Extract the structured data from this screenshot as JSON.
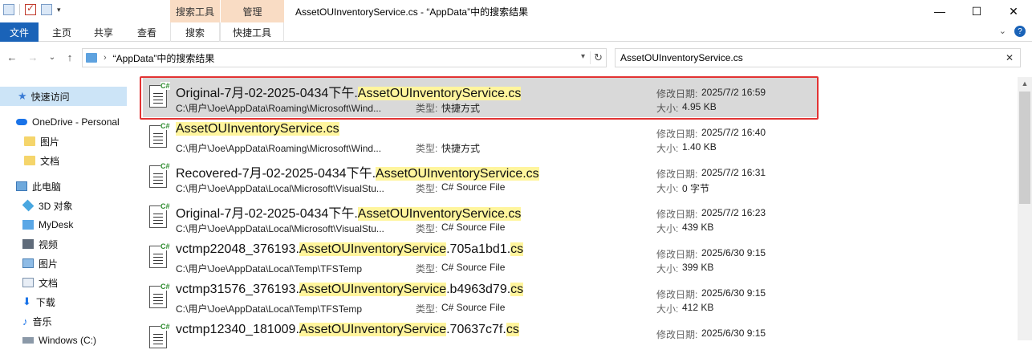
{
  "window": {
    "title": "AssetOUInventoryService.cs - “AppData”中的搜索结果",
    "minimize": "—",
    "maximize": "☐",
    "close": "✕"
  },
  "contextual": {
    "search_tools": "搜索工具",
    "manage": "管理"
  },
  "ribbon": {
    "tabs": [
      "文件",
      "主页",
      "共享",
      "查看",
      "搜索",
      "快捷工具"
    ]
  },
  "nav": {
    "back": "←",
    "forward": "→",
    "recent": "⌄",
    "up": "↑"
  },
  "address": {
    "path": "“AppData”中的搜索结果",
    "refresh": "↻"
  },
  "search": {
    "value": "AssetOUInventoryService.cs",
    "clear": "✕"
  },
  "sidebar": {
    "items": [
      {
        "label": "快速访问",
        "icon": "star-icon"
      },
      {
        "label": "OneDrive - Personal",
        "icon": "cloud-icon"
      },
      {
        "label": "图片",
        "icon": "folder-icon"
      },
      {
        "label": "文档",
        "icon": "folder-icon"
      },
      {
        "label": "此电脑",
        "icon": "computer-icon"
      },
      {
        "label": "3D 对象",
        "icon": "cube-icon"
      },
      {
        "label": "MyDesk",
        "icon": "desktop-icon"
      },
      {
        "label": "视频",
        "icon": "video-icon"
      },
      {
        "label": "图片",
        "icon": "picture-icon"
      },
      {
        "label": "文档",
        "icon": "document-icon"
      },
      {
        "label": "下载",
        "icon": "download-icon"
      },
      {
        "label": "音乐",
        "icon": "music-icon"
      },
      {
        "label": "Windows (C:)",
        "icon": "drive-icon"
      }
    ]
  },
  "labels": {
    "type": "类型:",
    "modified": "修改日期:",
    "size": "大小:"
  },
  "results": [
    {
      "name_pre": "Original-7月-02-2025-0434下午.",
      "name_hl": "AssetOUInventoryService.cs",
      "name_post": "",
      "name_hl2": "",
      "path": "C:\\用户\\Joe\\AppData\\Roaming\\Microsoft\\Wind...",
      "type": "快捷方式",
      "modified": "2025/7/2 16:59",
      "size": "4.95 KB",
      "selected": true
    },
    {
      "name_pre": "",
      "name_hl": "AssetOUInventoryService.cs",
      "name_post": "",
      "name_hl2": "",
      "path": "C:\\用户\\Joe\\AppData\\Roaming\\Microsoft\\Wind...",
      "type": "快捷方式",
      "modified": "2025/7/2 16:40",
      "size": "1.40 KB",
      "selected": false
    },
    {
      "name_pre": "Recovered-7月-02-2025-0434下午.",
      "name_hl": "AssetOUInventoryService.cs",
      "name_post": "",
      "name_hl2": "",
      "path": "C:\\用户\\Joe\\AppData\\Local\\Microsoft\\VisualStu...",
      "type": "C# Source File",
      "modified": "2025/7/2 16:31",
      "size": "0 字节",
      "selected": false
    },
    {
      "name_pre": "Original-7月-02-2025-0434下午.",
      "name_hl": "AssetOUInventoryService.cs",
      "name_post": "",
      "name_hl2": "",
      "path": "C:\\用户\\Joe\\AppData\\Local\\Microsoft\\VisualStu...",
      "type": "C# Source File",
      "modified": "2025/7/2 16:23",
      "size": "439 KB",
      "selected": false
    },
    {
      "name_pre": "vctmp22048_376193.",
      "name_hl": "AssetOUInventoryService",
      "name_post": ".705a1bd1.",
      "name_hl2": "cs",
      "path": "C:\\用户\\Joe\\AppData\\Local\\Temp\\TFSTemp",
      "type": "C# Source File",
      "modified": "2025/6/30 9:15",
      "size": "399 KB",
      "selected": false
    },
    {
      "name_pre": "vctmp31576_376193.",
      "name_hl": "AssetOUInventoryService",
      "name_post": ".b4963d79.",
      "name_hl2": "cs",
      "path": "C:\\用户\\Joe\\AppData\\Local\\Temp\\TFSTemp",
      "type": "C# Source File",
      "modified": "2025/6/30 9:15",
      "size": "412 KB",
      "selected": false
    },
    {
      "name_pre": "vctmp12340_181009.",
      "name_hl": "AssetOUInventoryService",
      "name_post": ".70637c7f.",
      "name_hl2": "cs",
      "path": "",
      "type": "",
      "modified": "2025/6/30 9:15",
      "size": "",
      "selected": false
    }
  ],
  "colors": {
    "accent": "#1a63b8",
    "contextual_tab": "#f9dcc4",
    "match_highlight": "#fff59d",
    "selection": "#d9d9d9",
    "annotation_box": "#e23333"
  }
}
